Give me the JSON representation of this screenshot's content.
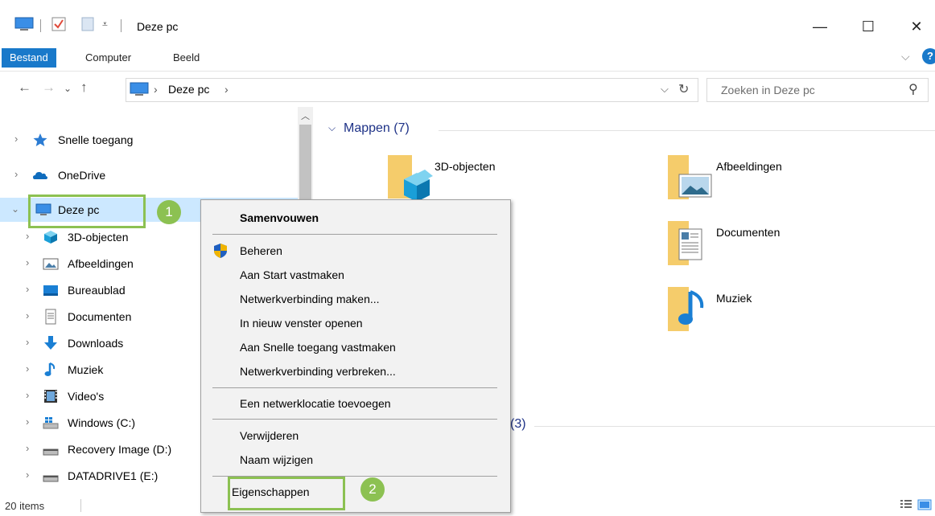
{
  "window": {
    "title": "Deze pc",
    "minimize": "—",
    "maximize": "☐",
    "close": "✕"
  },
  "ribbon": {
    "tabs": [
      "Bestand",
      "Computer",
      "Beeld"
    ],
    "collapse": "⌵",
    "help": "?"
  },
  "address": {
    "back": "←",
    "forward": "→",
    "recent": "⌄",
    "up": "↑",
    "path_sep": "›",
    "path": "Deze pc",
    "path_trail": "›",
    "dropdown": "⌵",
    "refresh": "↻",
    "search_placeholder": "Zoeken in Deze pc",
    "search_icon": "⚲"
  },
  "nav": {
    "items": [
      {
        "label": "Snelle toegang",
        "icon": "star-icon"
      },
      {
        "label": "OneDrive",
        "icon": "cloud-icon"
      },
      {
        "label": "Deze pc",
        "icon": "computer-icon"
      },
      {
        "label": "3D-objecten",
        "icon": "cube-icon"
      },
      {
        "label": "Afbeeldingen",
        "icon": "picture-icon"
      },
      {
        "label": "Bureaublad",
        "icon": "desktop-icon"
      },
      {
        "label": "Documenten",
        "icon": "document-icon"
      },
      {
        "label": "Downloads",
        "icon": "download-icon"
      },
      {
        "label": "Muziek",
        "icon": "music-icon"
      },
      {
        "label": "Video's",
        "icon": "video-icon"
      },
      {
        "label": "Windows (C:)",
        "icon": "windows-drive-icon"
      },
      {
        "label": "Recovery Image (D:)",
        "icon": "drive-icon"
      },
      {
        "label": "DATADRIVE1 (E:)",
        "icon": "drive-icon"
      }
    ]
  },
  "content": {
    "group_title": "Mappen (7)",
    "folders": [
      {
        "label": "3D-objecten"
      },
      {
        "label": "Afbeeldingen"
      },
      {
        "label": "Documenten"
      },
      {
        "label": "Muziek"
      }
    ],
    "second_group_fragment": "(3)"
  },
  "context_menu": {
    "items": [
      "Samenvouwen",
      "Beheren",
      "Aan Start vastmaken",
      "Netwerkverbinding maken...",
      "In nieuw venster openen",
      "Aan Snelle toegang vastmaken",
      "Netwerkverbinding verbreken...",
      "Een netwerklocatie toevoegen",
      "Verwijderen",
      "Naam wijzigen",
      "Eigenschappen"
    ]
  },
  "annotations": {
    "step1": "1",
    "step2": "2"
  },
  "status": {
    "items": "20 items"
  },
  "colors": {
    "accent": "#1979ca",
    "highlight": "#8cc152",
    "group_title": "#1e3287"
  }
}
